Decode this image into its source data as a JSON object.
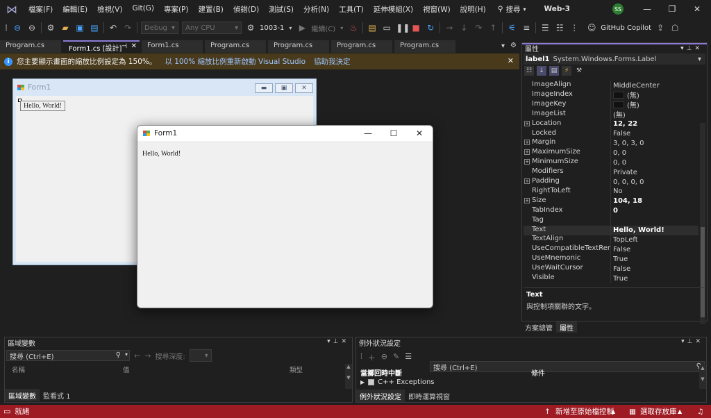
{
  "menu": {
    "items": [
      "檔案(F)",
      "編輯(E)",
      "檢視(V)",
      "Git(G)",
      "專案(P)",
      "建置(B)",
      "偵錯(D)",
      "測試(S)",
      "分析(N)",
      "工具(T)",
      "延伸模組(X)",
      "視窗(W)",
      "說明(H)"
    ],
    "search_label": "搜尋",
    "solution_name": "Web-3",
    "avatar_initials": "SS"
  },
  "toolbar": {
    "config": "Debug",
    "platform": "Any CPU",
    "target": "1003-1",
    "continue_label": "繼續(C)",
    "copilot_label": "GitHub Copilot"
  },
  "tabs": [
    {
      "label": "Program.cs",
      "active": false
    },
    {
      "label": "Form1.cs [設計]",
      "active": true
    },
    {
      "label": "Form1.cs",
      "active": false
    },
    {
      "label": "Program.cs",
      "active": false
    },
    {
      "label": "Program.cs",
      "active": false
    },
    {
      "label": "Program.cs",
      "active": false
    },
    {
      "label": "Program.cs",
      "active": false
    }
  ],
  "infobar": {
    "message": "您主要顯示畫面的縮放比例設定為 150%。",
    "action_restart": "以 100% 縮放比例重新啟動 Visual Studio",
    "action_help": "協助我決定"
  },
  "designer": {
    "form_title": "Form1",
    "label_text": "Hello, World!"
  },
  "running_form": {
    "title": "Form1",
    "label_text": "Hello, World!"
  },
  "properties": {
    "title": "屬性",
    "object_name": "label1",
    "object_type": "System.Windows.Forms.Label",
    "rows": [
      {
        "name": "ImageAlign",
        "value": "MiddleCenter",
        "expandable": false,
        "bold": false
      },
      {
        "name": "ImageIndex",
        "value": "(無)",
        "expandable": false,
        "bold": false,
        "swatch": true
      },
      {
        "name": "ImageKey",
        "value": "(無)",
        "expandable": false,
        "bold": false,
        "swatch": true
      },
      {
        "name": "ImageList",
        "value": "(無)",
        "expandable": false,
        "bold": false
      },
      {
        "name": "Location",
        "value": "12, 22",
        "expandable": true,
        "bold": true
      },
      {
        "name": "Locked",
        "value": "False",
        "expandable": false,
        "bold": false
      },
      {
        "name": "Margin",
        "value": "3, 0, 3, 0",
        "expandable": true,
        "bold": false
      },
      {
        "name": "MaximumSize",
        "value": "0, 0",
        "expandable": true,
        "bold": false
      },
      {
        "name": "MinimumSize",
        "value": "0, 0",
        "expandable": true,
        "bold": false
      },
      {
        "name": "Modifiers",
        "value": "Private",
        "expandable": false,
        "bold": false
      },
      {
        "name": "Padding",
        "value": "0, 0, 0, 0",
        "expandable": true,
        "bold": false
      },
      {
        "name": "RightToLeft",
        "value": "No",
        "expandable": false,
        "bold": false
      },
      {
        "name": "Size",
        "value": "104, 18",
        "expandable": true,
        "bold": true
      },
      {
        "name": "TabIndex",
        "value": "0",
        "expandable": false,
        "bold": true
      },
      {
        "name": "Tag",
        "value": "",
        "expandable": false,
        "bold": false
      },
      {
        "name": "Text",
        "value": "Hello, World!",
        "expandable": false,
        "bold": true,
        "selected": true
      },
      {
        "name": "TextAlign",
        "value": "TopLeft",
        "expandable": false,
        "bold": false
      },
      {
        "name": "UseCompatibleTextRendering",
        "value": "False",
        "expandable": false,
        "bold": false
      },
      {
        "name": "UseMnemonic",
        "value": "True",
        "expandable": false,
        "bold": false
      },
      {
        "name": "UseWaitCursor",
        "value": "False",
        "expandable": false,
        "bold": false
      },
      {
        "name": "Visible",
        "value": "True",
        "expandable": false,
        "bold": false
      }
    ],
    "desc_name": "Text",
    "desc_text": "與控制項關聯的文字。",
    "bottom_tabs": [
      "方案總管",
      "屬性"
    ]
  },
  "locals": {
    "title": "區域變數",
    "search_placeholder": "搜尋 (Ctrl+E)",
    "depth_label": "搜尋深度:",
    "col_name": "名稱",
    "col_value": "值",
    "col_type": "類型",
    "bottom_tabs": [
      "區域變數",
      "監看式 1"
    ]
  },
  "exceptions": {
    "title": "例外狀況設定",
    "search_placeholder": "搜尋 (Ctrl+E)",
    "col_break": "當擲回時中斷",
    "col_condition": "條件",
    "row_label": "C++ Exceptions",
    "bottom_tabs": [
      "例外狀況設定",
      "即時運算視窗"
    ]
  },
  "status": {
    "ready": "就緒",
    "add_source": "新增至原始檔控制",
    "select_repo": "選取存放庫"
  },
  "colors": {
    "status_bar": "#9e1b24",
    "accent": "#8c7ad6",
    "info_bar": "#4a3a1c"
  }
}
